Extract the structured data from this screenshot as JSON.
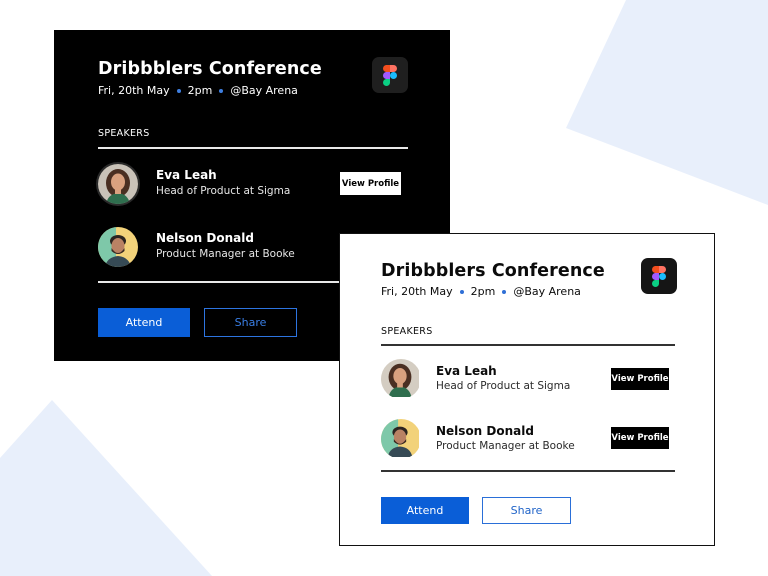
{
  "colors": {
    "accent": "#0a5ed7",
    "background_shape": "#e8effb",
    "dark_card": "#000000",
    "light_card": "#ffffff"
  },
  "cards": [
    {
      "theme": "dark",
      "title": "Dribbblers Conference",
      "date": "Fri, 20th May",
      "time": "2pm",
      "venue": "@Bay Arena",
      "app_icon": "figma-icon",
      "speakers_label": "SPEAKERS",
      "speakers": [
        {
          "name": "Eva Leah",
          "role": "Head of Product at Sigma",
          "action": "View Profile"
        },
        {
          "name": "Nelson Donald",
          "role": "Product Manager at Booke"
        }
      ],
      "attend_label": "Attend",
      "share_label": "Share"
    },
    {
      "theme": "light",
      "title": "Dribbblers Conference",
      "date": "Fri, 20th May",
      "time": "2pm",
      "venue": "@Bay Arena",
      "app_icon": "figma-icon",
      "speakers_label": "SPEAKERS",
      "speakers": [
        {
          "name": "Eva Leah",
          "role": "Head of Product at Sigma",
          "action": "View Profile"
        },
        {
          "name": "Nelson Donald",
          "role": "Product Manager at Booke",
          "action": "View Profile"
        }
      ],
      "attend_label": "Attend",
      "share_label": "Share"
    }
  ]
}
